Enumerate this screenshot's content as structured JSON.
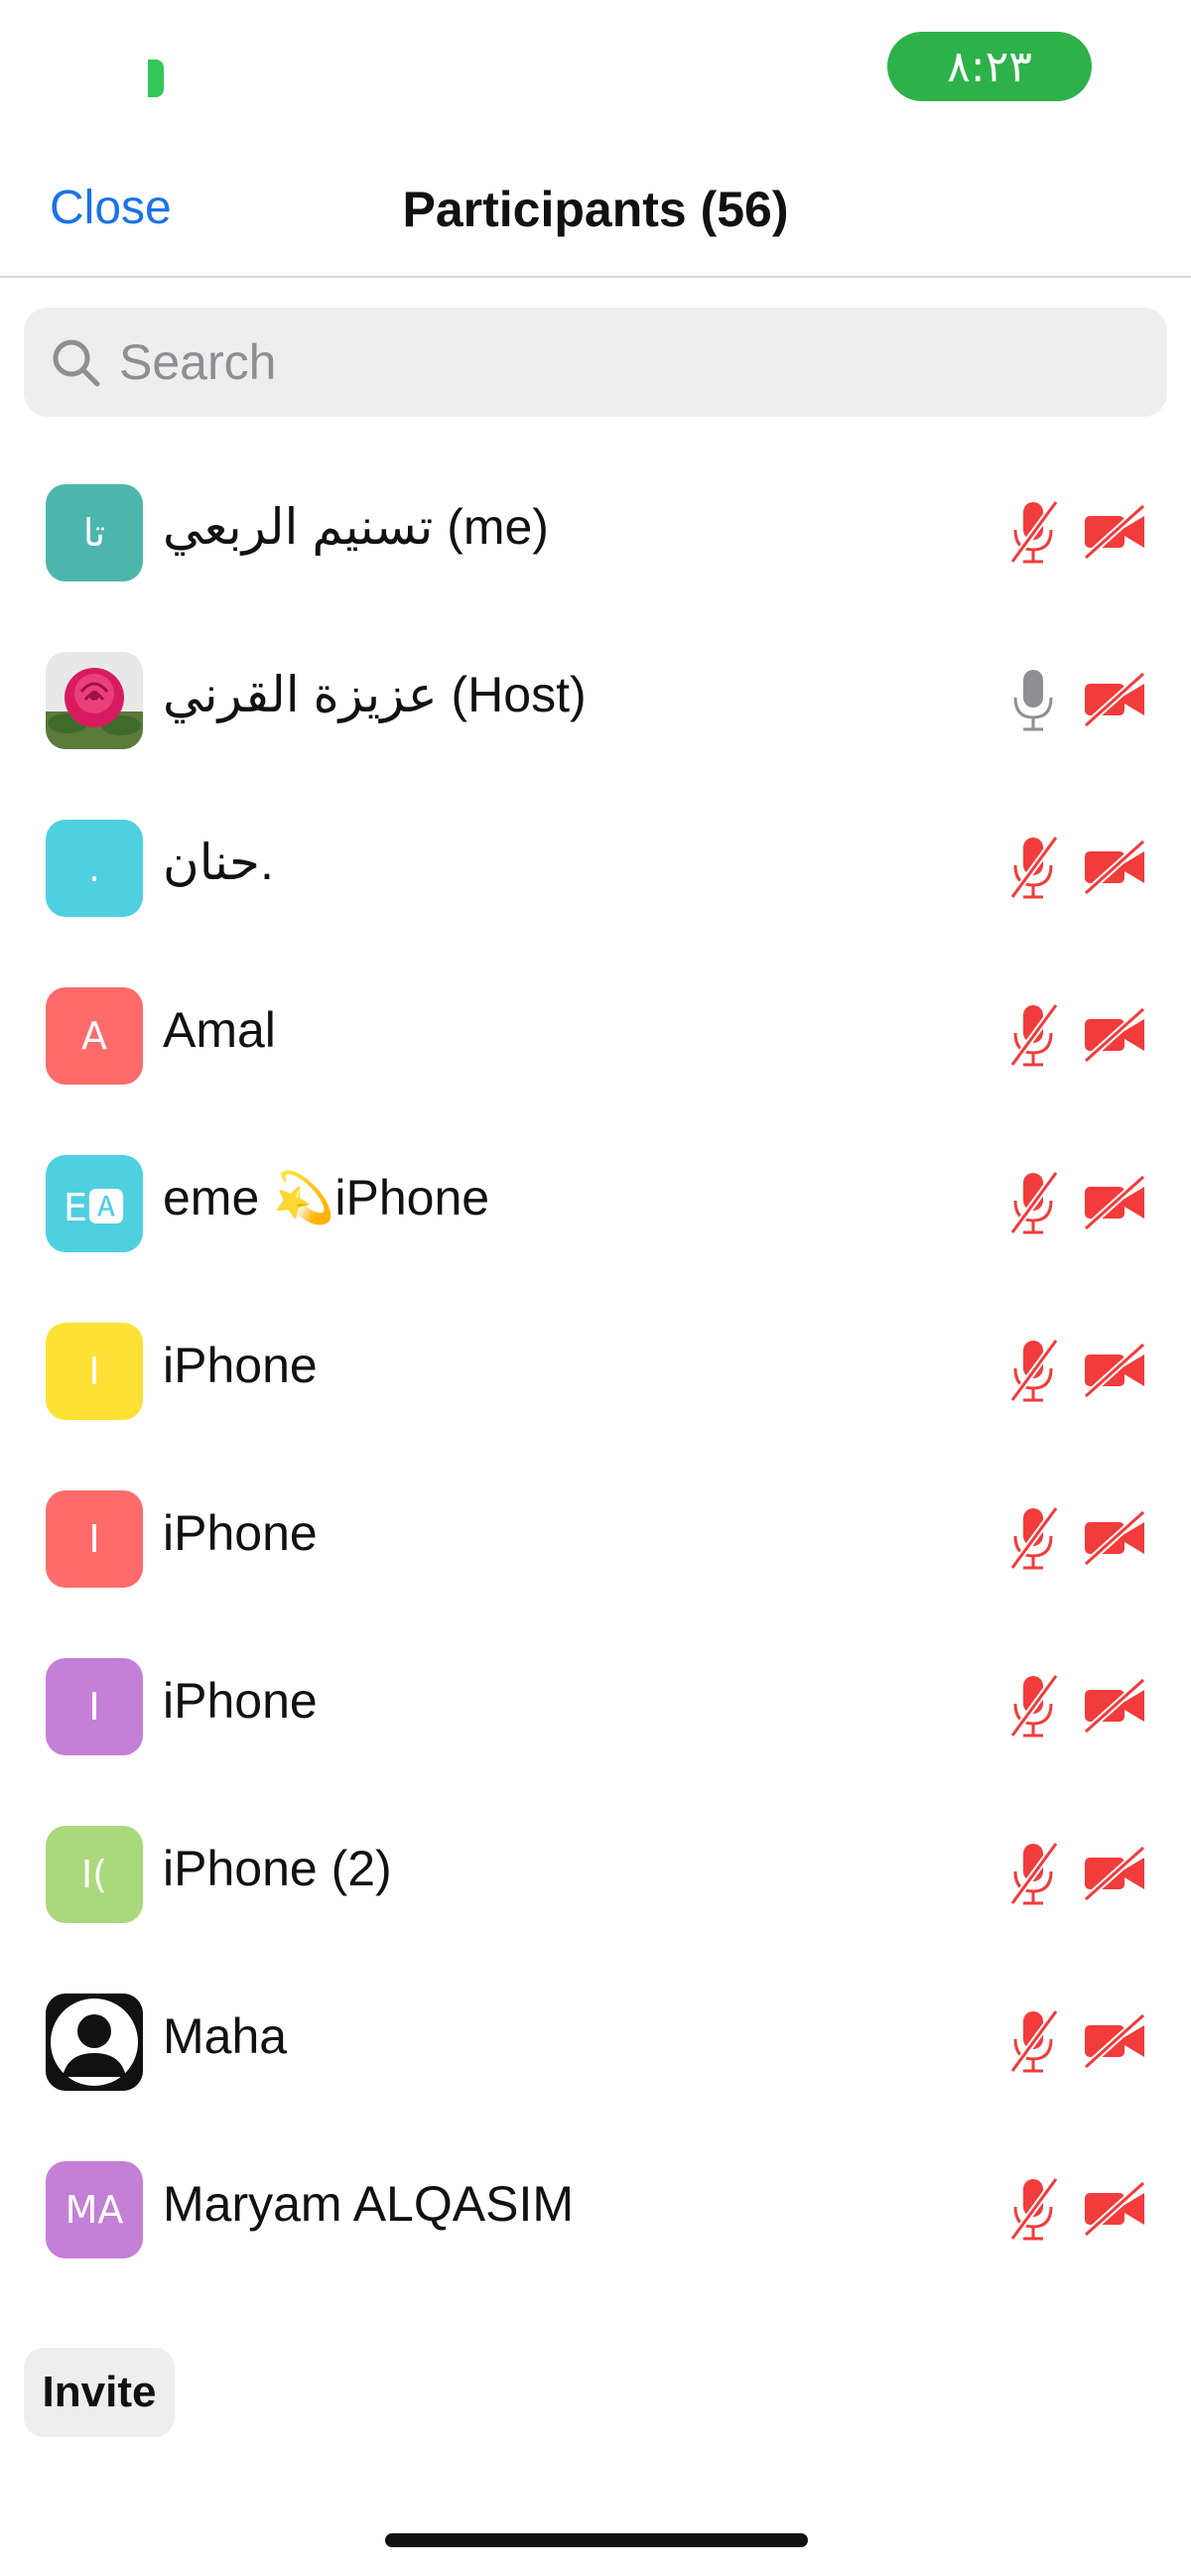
{
  "status_bar": {
    "time": "٨:٢٣"
  },
  "header": {
    "close_label": "Close",
    "title": "Participants (56)"
  },
  "search": {
    "placeholder": "Search"
  },
  "participants": [
    {
      "name": "تسنيم الربعي (me)",
      "avatar_text": "تا",
      "avatar_color": "#4db6ac",
      "avatar_icon": "",
      "mic": "muted",
      "video": "off"
    },
    {
      "name": "عزيزة القرني (Host)",
      "avatar_text": "",
      "avatar_color": "#ffffff",
      "avatar_icon": "rose-photo-icon",
      "mic": "unmuted",
      "video": "off"
    },
    {
      "name": "حنان.",
      "avatar_text": ".",
      "avatar_color": "#4fd0e0",
      "avatar_icon": "",
      "mic": "muted",
      "video": "off"
    },
    {
      "name": "Amal",
      "avatar_text": "A",
      "avatar_color": "#ff6b6b",
      "avatar_icon": "",
      "mic": "muted",
      "video": "off"
    },
    {
      "name": "eme 💫iPhone",
      "avatar_text": "E🅰",
      "avatar_color": "#4fd0e0",
      "avatar_icon": "",
      "mic": "muted",
      "video": "off"
    },
    {
      "name": "iPhone",
      "avatar_text": "I",
      "avatar_color": "#ffe135",
      "avatar_icon": "",
      "mic": "muted",
      "video": "off"
    },
    {
      "name": "iPhone",
      "avatar_text": "I",
      "avatar_color": "#ff6b6b",
      "avatar_icon": "",
      "mic": "muted",
      "video": "off"
    },
    {
      "name": "iPhone",
      "avatar_text": "I",
      "avatar_color": "#c47fd6",
      "avatar_icon": "",
      "mic": "muted",
      "video": "off"
    },
    {
      "name": "iPhone (2)",
      "avatar_text": "I(",
      "avatar_color": "#a9d97c",
      "avatar_icon": "",
      "mic": "muted",
      "video": "off"
    },
    {
      "name": "Maha",
      "avatar_text": "",
      "avatar_color": "#ffffff",
      "avatar_icon": "person-silhouette-icon",
      "mic": "muted",
      "video": "off"
    },
    {
      "name": "Maryam ALQASIM",
      "avatar_text": "MA",
      "avatar_color": "#c47fd6",
      "avatar_icon": "",
      "mic": "muted",
      "video": "off"
    }
  ],
  "footer": {
    "invite_label": "Invite"
  },
  "colors": {
    "accent": "#1a73e8",
    "muted_red": "#f23b3b",
    "time_pill": "#2db24a",
    "unmuted_gray": "#8e8e93"
  }
}
